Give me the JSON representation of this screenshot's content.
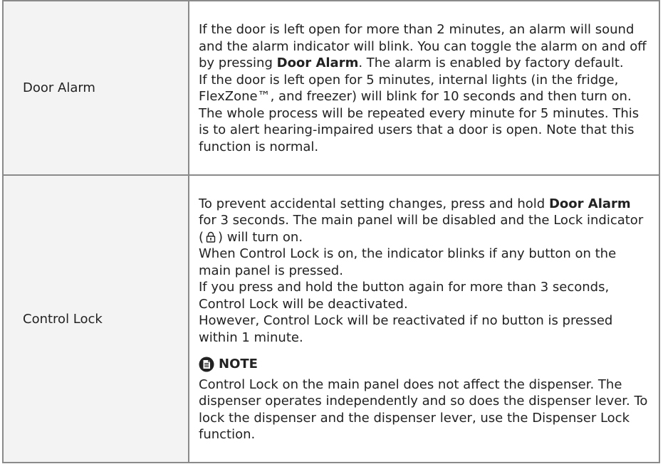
{
  "rows": [
    {
      "label": "Door Alarm",
      "paragraphs": [
        {
          "before": "If the door is left open for more than 2 minutes, an alarm will sound and the alarm indicator will blink. You can toggle the alarm on and off by pressing ",
          "bold": "Door Alarm",
          "after": ". The alarm is enabled by factory default."
        },
        {
          "text": "If the door is left open for 5 minutes, internal lights (in the fridge, FlexZone™, and freezer) will blink for 10 seconds and then turn on. The whole process will be repeated every minute for 5 minutes. This is to alert hearing-impaired users that a door is open. Note that this function is normal."
        }
      ]
    },
    {
      "label": "Control Lock",
      "paragraphs": [
        {
          "before": "To prevent accidental setting changes, press and hold ",
          "bold": "Door Alarm",
          "middle": " for 3 seconds. The main panel will be disabled and the Lock indicator (",
          "after": ") will turn on."
        },
        {
          "text": "When Control Lock is on, the indicator blinks if any button on the main panel is pressed."
        },
        {
          "text": "If you press and hold the button again for more than 3 seconds, Control Lock will be deactivated."
        },
        {
          "text": "However, Control Lock will be reactivated if no button is pressed within 1 minute."
        }
      ],
      "note": {
        "title": "NOTE",
        "icon": "note-icon",
        "text": "Control Lock on the main panel does not affect the dispenser. The dispenser operates independently and so does the dispenser lever. To lock the dispenser and the dispenser lever, use the Dispenser Lock function."
      }
    }
  ],
  "colors": {
    "label_bg": "#f3f3f3",
    "border": "#8a8a8a",
    "text": "#222222"
  }
}
